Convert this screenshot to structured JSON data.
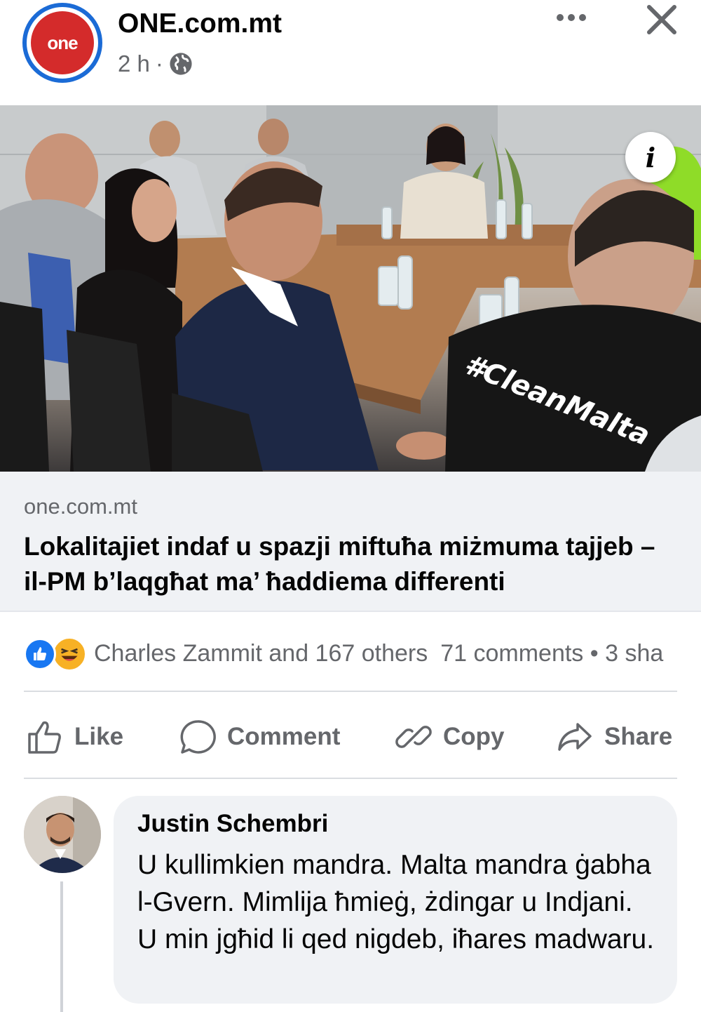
{
  "post": {
    "page_name": "ONE.com.mt",
    "avatar_text": "one",
    "time": "2 h",
    "separator": "·"
  },
  "photo": {
    "shirt_text": "#CleanMalta",
    "info_label": "i"
  },
  "link": {
    "domain": "one.com.mt",
    "title": "Lokalitajiet indaf u spazji miftuħa miżmuma tajjeb – il-PM b’laqgħat ma’ ħaddiema differenti"
  },
  "stats": {
    "reactions": "Charles Zammit and 167 others",
    "comments_shares": "71 comments • 3 sha"
  },
  "actions": {
    "like": "Like",
    "comment": "Comment",
    "copy": "Copy",
    "share": "Share"
  },
  "comment": {
    "author": "Justin Schembri",
    "text": "U kullimkien mandra. Malta mandra ġabha l-Gvern. Mimlija ħmieġ, żdingar u Indjani. U min jgħid li qed nigdeb, iħares madwaru."
  },
  "colors": {
    "brand_blue": "#1877f2",
    "avatar_ring": "#1b6bd6",
    "avatar_red": "#d42b2b",
    "muted_text": "#65676b",
    "link_bg": "#f0f2f5"
  }
}
